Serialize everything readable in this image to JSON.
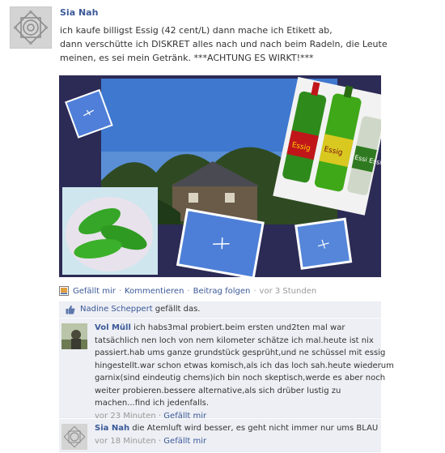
{
  "post": {
    "author": "Sia Nah",
    "lines": [
      "ich kaufe billigst Essig (42 cent/L) dann mache ich Etikett ab,",
      "dann verschütte ich DISKRET alles nach und nach beim Radeln, die Leute",
      "meinen, es sei mein Getränk. ***ACHTUNG ES WIRKT!***"
    ],
    "photo_labels": {
      "bottle_1": "Essig",
      "bottle_2": "Essig",
      "bottle_3": "Essi Essi"
    }
  },
  "actions": {
    "like": "Gefällt mir",
    "comment": "Kommentieren",
    "follow": "Beitrag folgen",
    "time": "vor 3 Stunden",
    "sep": "·"
  },
  "likes": {
    "name": "Nadine Scheppert",
    "suffix": " gefällt das."
  },
  "comments": [
    {
      "author": "Vol Müll",
      "first_line": "ich habs3mal probiert.beim ersten und2ten mal war",
      "lines": [
        "tatsächlich nen loch von nem kilometer schätze ich mal.heute ist nix",
        "passiert.hab ums ganze grundstück gesprüht,und ne schüssel mit essig",
        "hingestellt.war schon etwas komisch,als ich das loch sah.heute wiederum",
        "garnix(sind eindeutig chems)ich bin noch skeptisch,werde es aber noch",
        "weiter probieren.bessere alternative,als sich drüber lustig zu",
        "machen...find ich jedenfalls."
      ],
      "time": "vor 23 Minuten",
      "like": "Gefällt mir"
    },
    {
      "author": "Sia Nah",
      "first_line": "die Atemluft wird besser, es geht nicht immer nur ums BLAU",
      "time": "vor 18 Minuten",
      "like": "Gefällt mir"
    }
  ],
  "colors": {
    "link": "#3b5998",
    "comment_bg": "#edeff4",
    "photo_bg": "#2c2b55"
  }
}
